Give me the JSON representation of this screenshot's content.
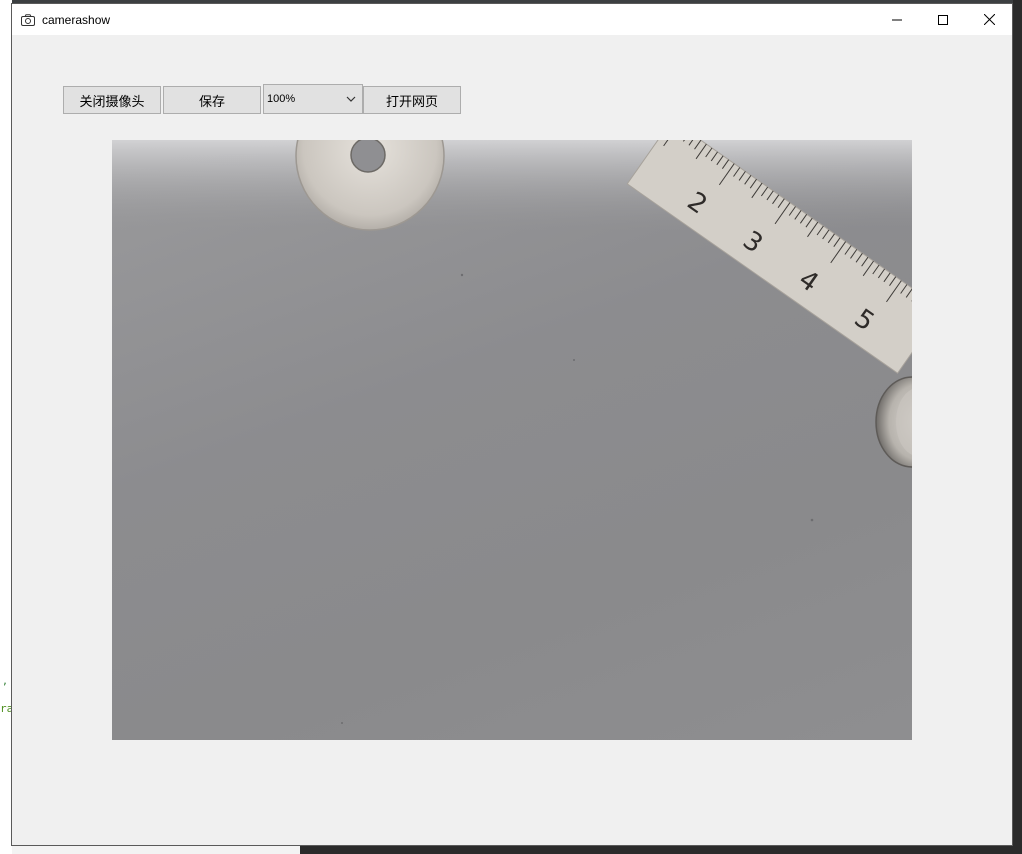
{
  "window": {
    "title": "camerashow",
    "icons": {
      "app": "camera-icon",
      "minimize": "minimize-icon",
      "maximize": "maximize-icon",
      "close": "close-icon"
    }
  },
  "toolbar": {
    "close_camera_label": "关闭摄像头",
    "save_label": "保存",
    "zoom": {
      "value": "100%",
      "icon": "chevron-down-icon"
    },
    "open_webpage_label": "打开网页"
  },
  "camera_view": {
    "ruler_numbers": [
      "2",
      "3",
      "4",
      "5"
    ],
    "colors": {
      "surface": "#8c8c8f",
      "metal": "#cfcac4",
      "ruler": "#d6d2cc"
    }
  }
}
